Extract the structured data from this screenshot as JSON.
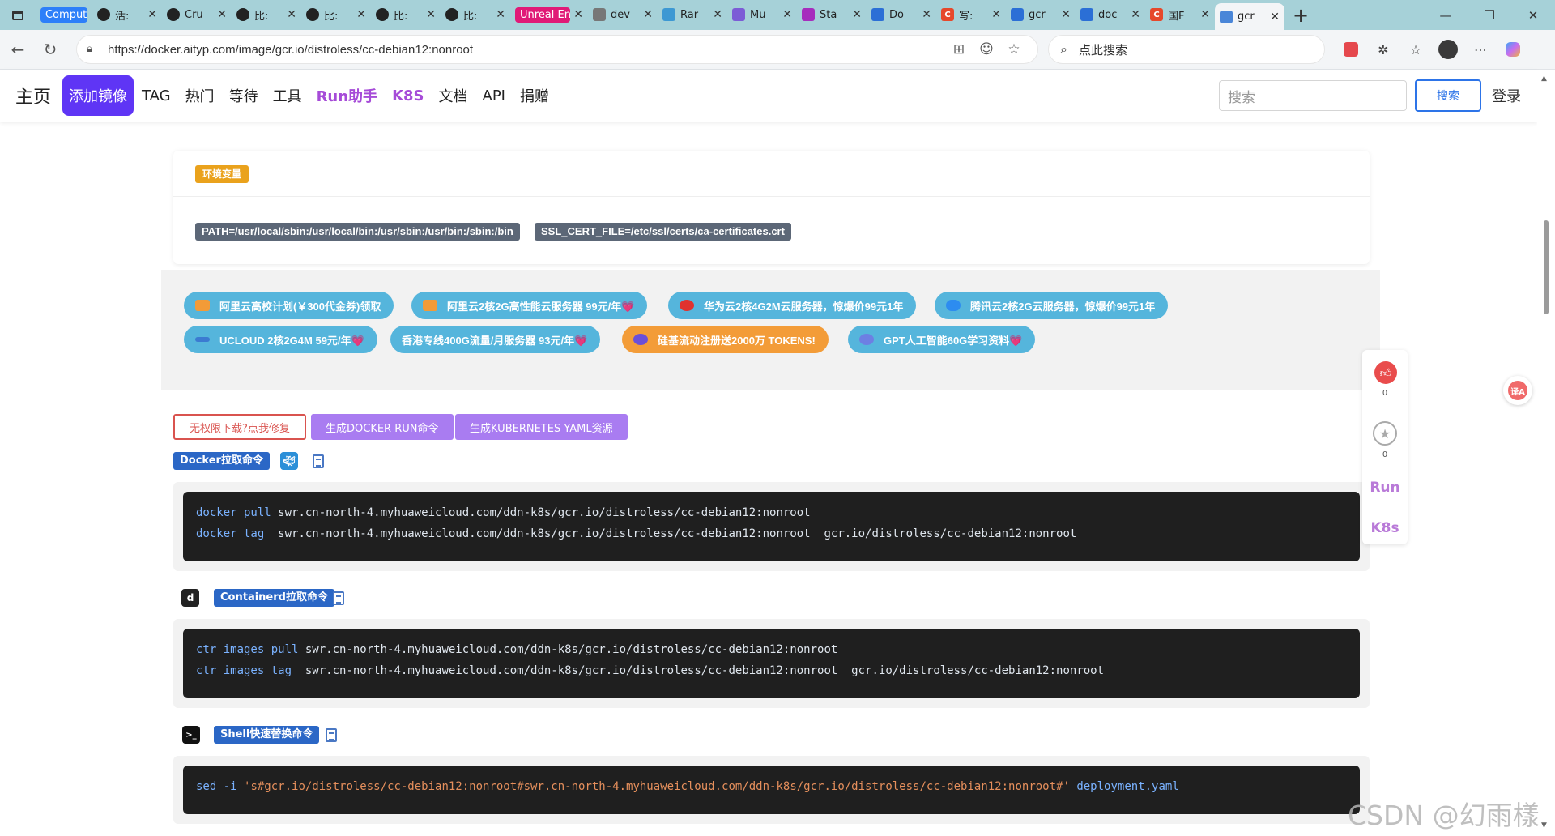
{
  "browser": {
    "tabs": [
      {
        "label": "Compute",
        "icon": "computer-icon",
        "color": "#2d7ff9",
        "pill": true
      },
      {
        "label": "活:",
        "icon": "github-icon"
      },
      {
        "label": "Cru",
        "icon": "github-icon"
      },
      {
        "label": "比:",
        "icon": "github-icon"
      },
      {
        "label": "比:",
        "icon": "github-icon"
      },
      {
        "label": "比:",
        "icon": "github-icon"
      },
      {
        "label": "比:",
        "icon": "github-icon"
      },
      {
        "label": "Unreal En",
        "icon": "unreal-icon",
        "color": "#e01a77",
        "pill": true
      },
      {
        "label": "dev",
        "icon": "page-icon"
      },
      {
        "label": "Rar",
        "icon": "rancher-icon"
      },
      {
        "label": "Mu",
        "icon": "mu-icon"
      },
      {
        "label": "Sta",
        "icon": "star-logo-icon"
      },
      {
        "label": "Do",
        "icon": "docker-icon"
      },
      {
        "label": "写:",
        "icon": "csdn-icon"
      },
      {
        "label": "gcr",
        "icon": "search-icon"
      },
      {
        "label": "doc",
        "icon": "search-icon"
      },
      {
        "label": "国F",
        "icon": "csdn-icon"
      },
      {
        "label": "gcr",
        "icon": "cube-icon",
        "active": true
      }
    ],
    "url": "https://docker.aityp.com/image/gcr.io/distroless/cc-debian12:nonroot",
    "search_placeholder": "点此搜索"
  },
  "nav": {
    "brand": "主页",
    "items": [
      "添加镜像",
      "TAG",
      "热门",
      "等待",
      "工具",
      "Run助手",
      "K8S",
      "文档",
      "API",
      "捐赠"
    ],
    "search_placeholder": "搜索",
    "search_button": "搜索",
    "login": "登录"
  },
  "env": {
    "badge": "环境变量",
    "vars": [
      "PATH=/usr/local/sbin:/usr/local/bin:/usr/sbin:/usr/bin:/sbin:/bin",
      "SSL_CERT_FILE=/etc/ssl/certs/ca-certificates.crt"
    ]
  },
  "promos": [
    {
      "text": "阿里云高校计划(￥300代金券)领取",
      "icon": "aliyun-icon"
    },
    {
      "text": "阿里云2核2G高性能云服务器 99元/年💗",
      "icon": "aliyun-icon"
    },
    {
      "text": "华为云2核4G2M云服务器，惊爆价99元1年",
      "icon": "huawei-icon"
    },
    {
      "text": "腾讯云2核2G云服务器，惊爆价99元1年",
      "icon": "tencent-cloud-icon"
    },
    {
      "text": "UCLOUD 2核2G4M 59元/年💗",
      "icon": "ucloud-icon"
    },
    {
      "text": "香港专线400G流量/月服务器 93元/年💗",
      "icon": ""
    },
    {
      "text": "硅基流动注册送2000万 TOKENS!",
      "icon": "siliconflow-icon",
      "color": "#f39c38"
    },
    {
      "text": "GPT人工智能60G学习资料💗",
      "icon": "gpt-icon"
    }
  ],
  "actions": {
    "fix_button": "无权限下载?点我修复",
    "docker_run_button": "生成DOCKER RUN命令",
    "k8s_yaml_button": "生成KUBERNETES YAML资源"
  },
  "docker": {
    "tag": "Docker拉取命令",
    "lines": [
      {
        "cmd": "docker pull",
        "args": "swr.cn-north-4.myhuaweicloud.com/ddn-k8s/gcr.io/distroless/cc-debian12:nonroot"
      },
      {
        "cmd": "docker tag",
        "args": " swr.cn-north-4.myhuaweicloud.com/ddn-k8s/gcr.io/distroless/cc-debian12:nonroot  gcr.io/distroless/cc-debian12:nonroot"
      }
    ]
  },
  "containerd": {
    "tag": "Containerd拉取命令",
    "lines": [
      {
        "cmd": "ctr images pull",
        "args": "swr.cn-north-4.myhuaweicloud.com/ddn-k8s/gcr.io/distroless/cc-debian12:nonroot"
      },
      {
        "cmd": "ctr images tag",
        "args": " swr.cn-north-4.myhuaweicloud.com/ddn-k8s/gcr.io/distroless/cc-debian12:nonroot  gcr.io/distroless/cc-debian12:nonroot"
      }
    ]
  },
  "shell": {
    "tag": "Shell快速替换命令",
    "line": {
      "cmd": "sed -i",
      "str": "'s#gcr.io/distroless/cc-debian12:nonroot#swr.cn-north-4.myhuaweicloud.com/ddn-k8s/gcr.io/distroless/cc-debian12:nonroot#'",
      "tail": "deployment.yaml"
    }
  },
  "float_bar": {
    "like_count": "0",
    "star_count": "0",
    "run_label": "Run",
    "k8s_label": "K8s"
  },
  "watermark": "CSDN @幻雨樣"
}
